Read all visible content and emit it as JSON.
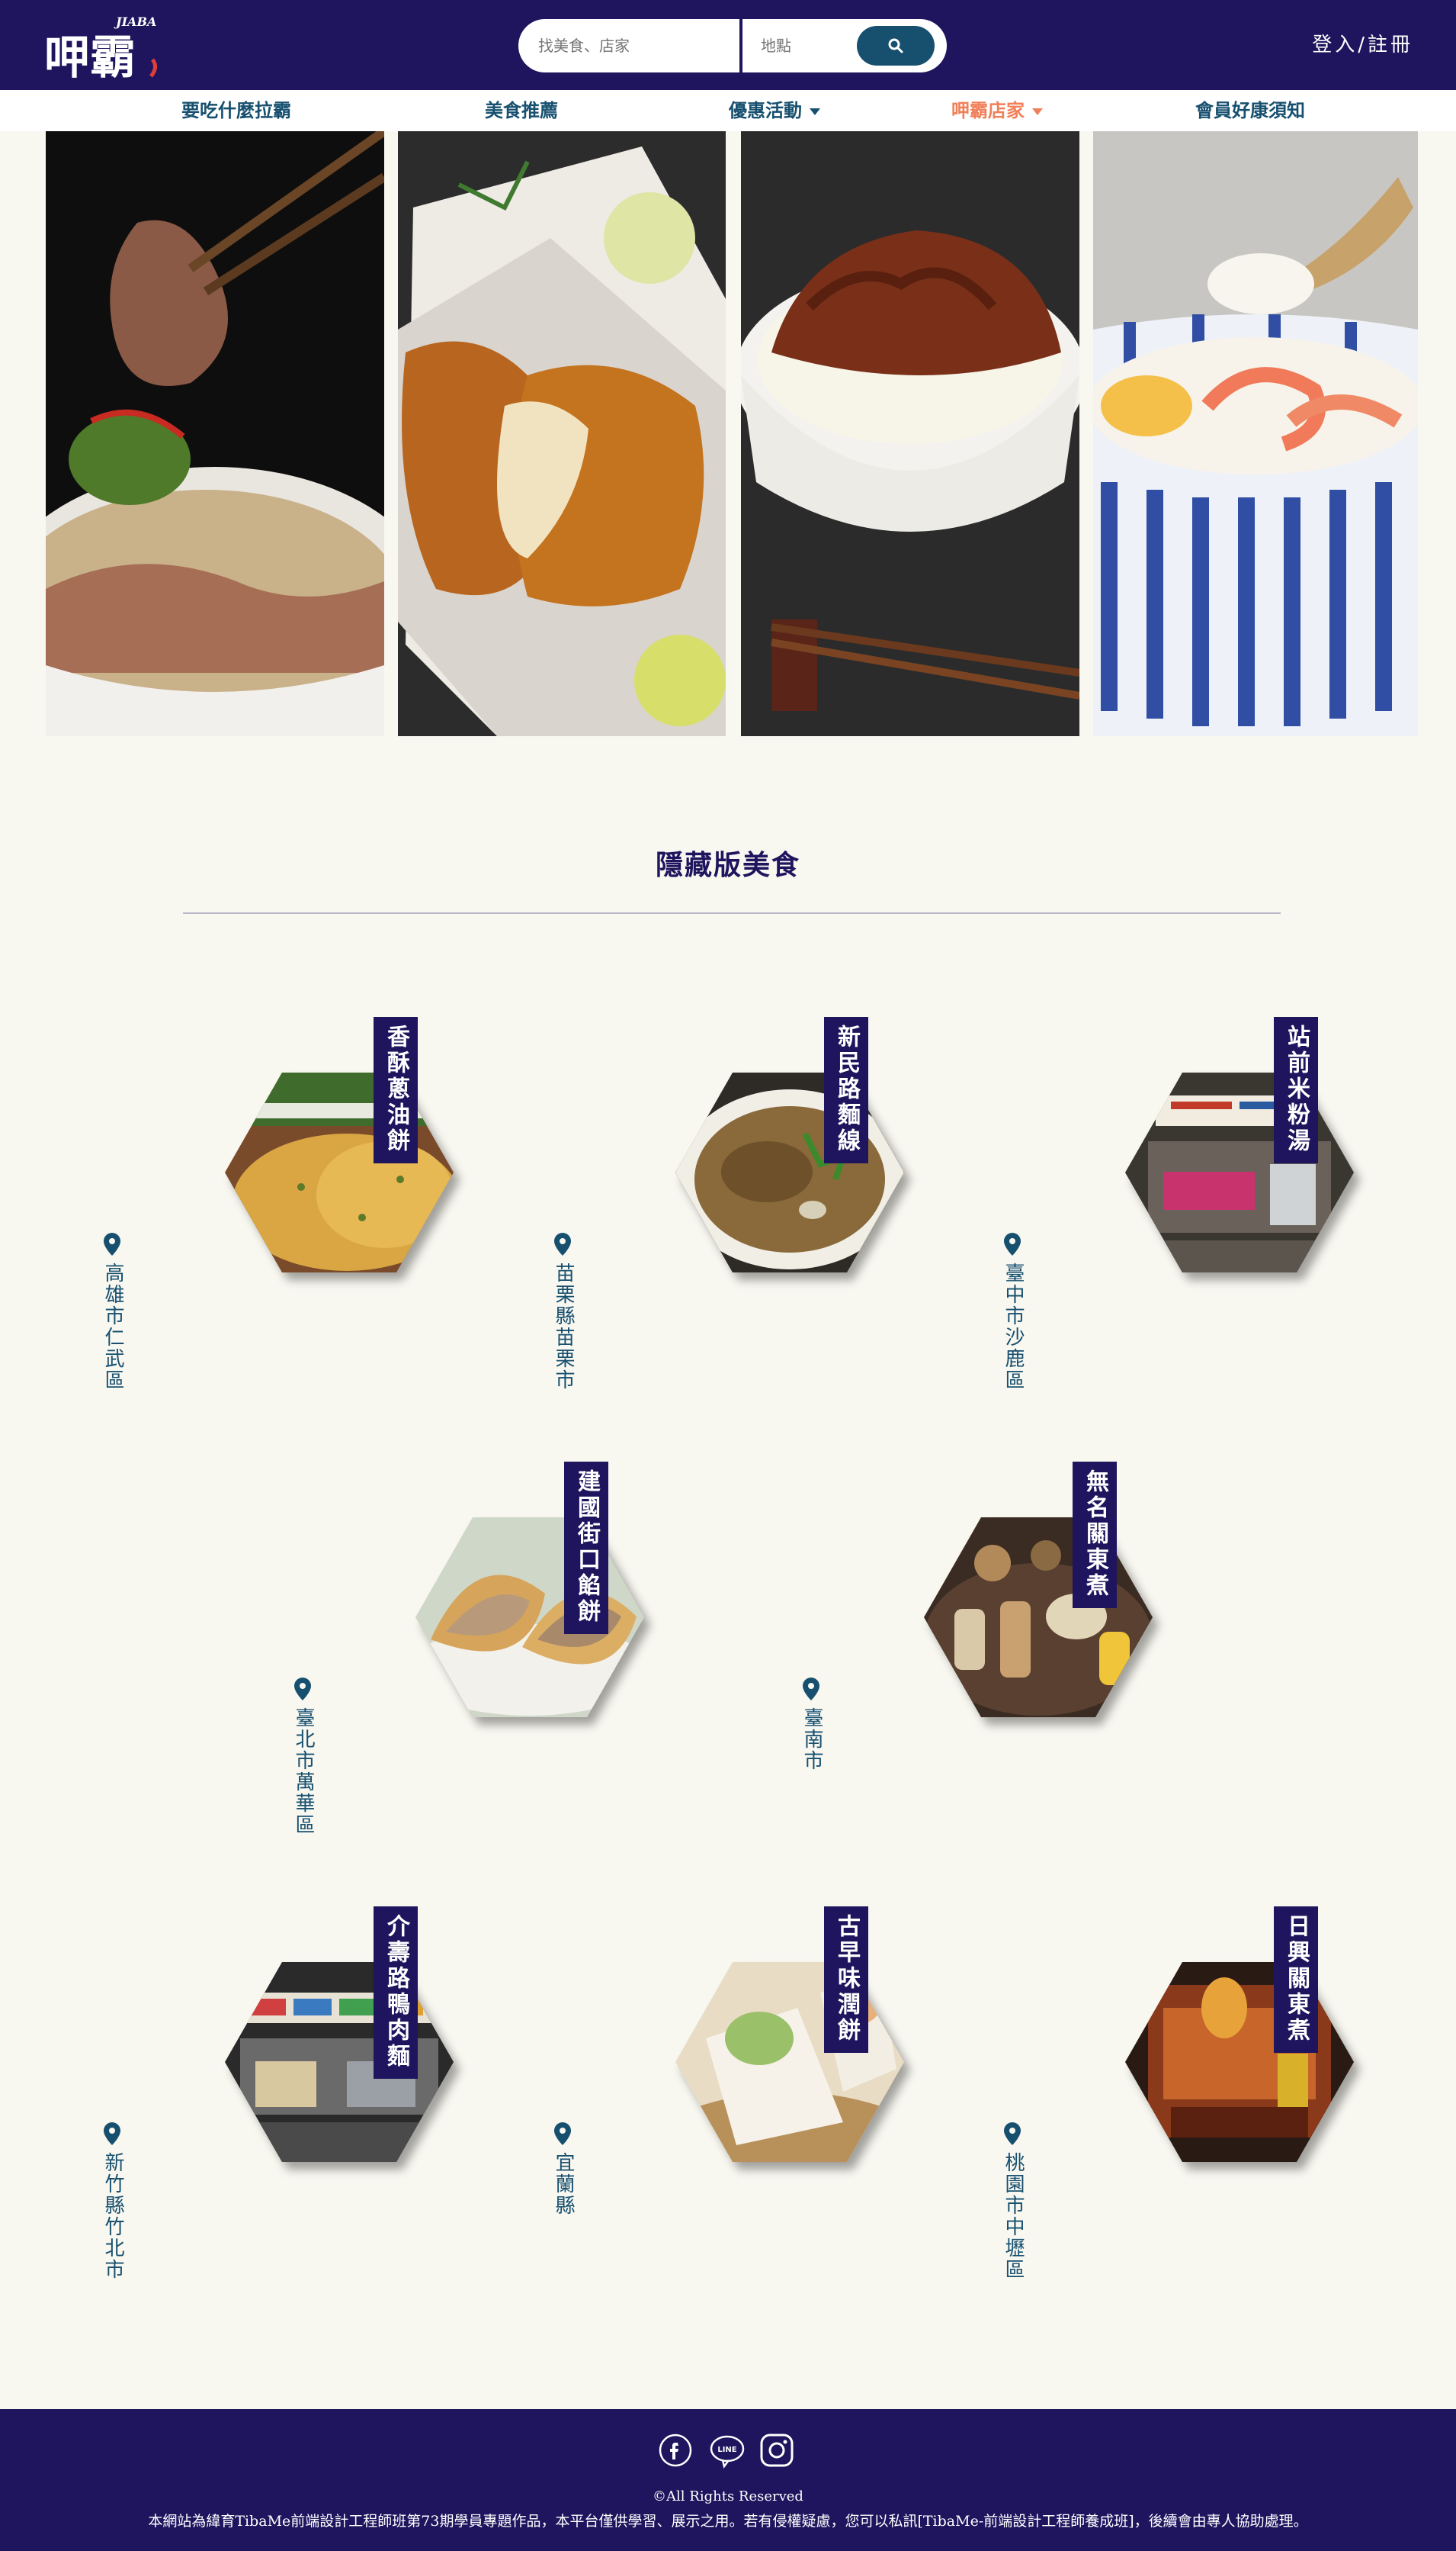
{
  "header": {
    "logo_text": "呷霸",
    "logo_sub": "JIABA",
    "search_placeholder": "找美食、店家",
    "location_placeholder": "地點",
    "auth_label": "登入/註冊"
  },
  "nav": {
    "items": [
      {
        "label": "要吃什麼拉霸",
        "dropdown": false
      },
      {
        "label": "美食推薦",
        "dropdown": false
      },
      {
        "label": "優惠活動",
        "dropdown": true
      },
      {
        "label": "呷霸店家",
        "dropdown": true,
        "active": true
      },
      {
        "label": "會員好康須知",
        "dropdown": false
      }
    ]
  },
  "banner": {
    "images": [
      {
        "alt": "牛肉麵"
      },
      {
        "alt": "炸雞排"
      },
      {
        "alt": "滷肉飯"
      },
      {
        "alt": "海鮮粥"
      }
    ]
  },
  "section": {
    "title": "隱藏版美食"
  },
  "foods": [
    {
      "name": "香酥蔥油餅",
      "location": "高雄市仁武區"
    },
    {
      "name": "新民路麵線",
      "location": "苗栗縣苗栗市"
    },
    {
      "name": "站前米粉湯",
      "location": "臺中市沙鹿區"
    },
    {
      "name": "建國街口餡餅",
      "location": "臺北市萬華區"
    },
    {
      "name": "無名關東煮",
      "location": "臺南市"
    },
    {
      "name": "介壽路鴨肉麵",
      "location": "新竹縣竹北市"
    },
    {
      "name": "古早味潤餅",
      "location": "宜蘭縣"
    },
    {
      "name": "日興關東煮",
      "location": "桃園市中壢區"
    }
  ],
  "footer": {
    "social": [
      "facebook-icon",
      "line-icon",
      "instagram-icon"
    ],
    "line_label": "LINE",
    "copyright": "©All Rights Reserved",
    "notice": "本網站為緯育TibaMe前端設計工程師班第73期學員專題作品，本平台僅供學習、展示之用。若有侵權疑慮，您可以私訊[TibaMe-前端設計工程師養成班]，後續會由專人協助處理。"
  },
  "colors": {
    "navy": "#1e155e",
    "teal": "#17506f",
    "accent": "#f0805a",
    "background": "#f8f7f0"
  }
}
